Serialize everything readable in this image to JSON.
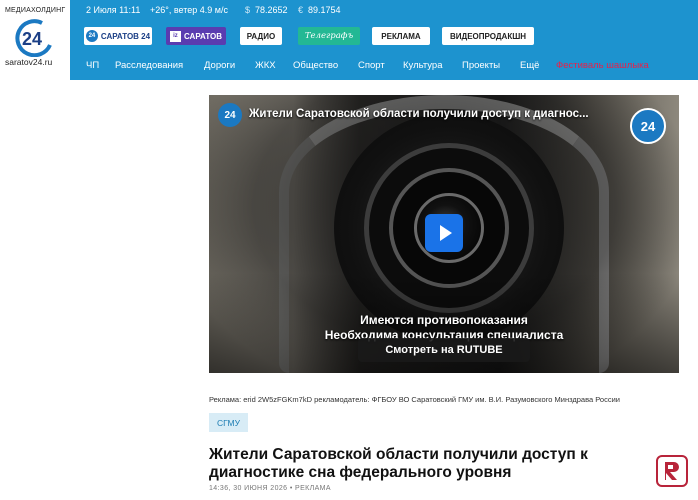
{
  "logo": {
    "brand": "МЕДИАХОЛДИНГ",
    "number": "24",
    "site": "saratov24.ru"
  },
  "topbar": {
    "date_time": "2 Июля 11:11",
    "weather": "+26°, ветер 4.9 м/с",
    "usd_symbol": "$",
    "usd_rate": "78.2652",
    "eur_symbol": "€",
    "eur_rate": "89.1754"
  },
  "buttons": {
    "saratov24": "САРАТОВ 24",
    "saratov24_icon": "24",
    "izsaratov": "САРАТОВ",
    "izsaratov_icon": "iz",
    "radio": "РАДИО",
    "telegraf": "Телеграфъ",
    "reklama": "РЕКЛАМА",
    "videoprod": "ВИДЕОПРОДАКШН"
  },
  "nav": {
    "items": [
      "ЧП",
      "Расследования",
      "Дороги",
      "ЖКХ",
      "Общество",
      "Спорт",
      "Культура",
      "Проекты",
      "Ещё"
    ],
    "festival": "Фестиваль шашлыка"
  },
  "video": {
    "title": "Жители Саратовской области получили доступ к диагнос...",
    "logo_text": "24",
    "warning_line1": "Имеются противопоказания",
    "warning_line2": "Необходима консультация специалиста",
    "rutube_button": "Смотреть на RUTUBE"
  },
  "article": {
    "ad_note": "Реклама: erid 2W5zFGKm7kD рекламодатель: ФГБОУ ВО Саратовский ГМУ им. В.И. Разумовского Минздрава России",
    "tag": "СГМУ",
    "headline": "Жители Саратовской области получили доступ к диагностике сна федерального уровня",
    "meta": "14:36, 30 ИЮНЯ 2026 • РЕКЛАМА"
  },
  "colors": {
    "header_blue": "#1d93cf",
    "festival_red": "#e5224c",
    "play_blue": "#1a73e8",
    "tag_bg": "#d8ecf6"
  },
  "icons": {
    "play": "play-icon",
    "reader": "reader-logo-icon"
  }
}
